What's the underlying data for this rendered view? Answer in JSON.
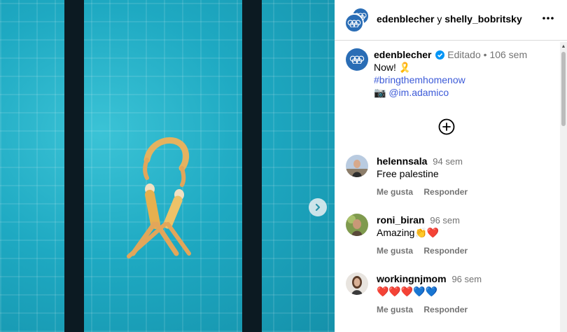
{
  "post": {
    "header": {
      "user1": "edenblecher",
      "joiner": "y",
      "user2": "shelly_bobritsky",
      "more_icon": "more-horizontal-icon"
    },
    "caption": {
      "username": "edenblecher",
      "verified": true,
      "edited": "Editado",
      "separator": "•",
      "time": "106 sem",
      "line1": "Now!",
      "ribbon_emoji": "🎗️",
      "hashtag": "#bringthemhomenow",
      "camera_emoji": "📷",
      "mention": "@im.adamico"
    },
    "add_icon": "plus-circle-icon",
    "next_icon": "chevron-right-icon"
  },
  "comments": [
    {
      "username": "helennsala",
      "time": "94 sem",
      "text": "Free palestine",
      "like": "Me gusta",
      "reply": "Responder"
    },
    {
      "username": "roni_biran",
      "time": "96 sem",
      "text": "Amazing👏❤️",
      "like": "Me gusta",
      "reply": "Responder"
    },
    {
      "username": "workingnjmom",
      "time": "96 sem",
      "text": "❤️❤️❤️💙💙",
      "like": "Me gusta",
      "reply": "Responder"
    }
  ],
  "colors": {
    "pool": "#1ea9c2",
    "lane": "#0c1a22",
    "link": "#3d5bd8",
    "verified": "#0095f6",
    "muted": "#737373"
  }
}
